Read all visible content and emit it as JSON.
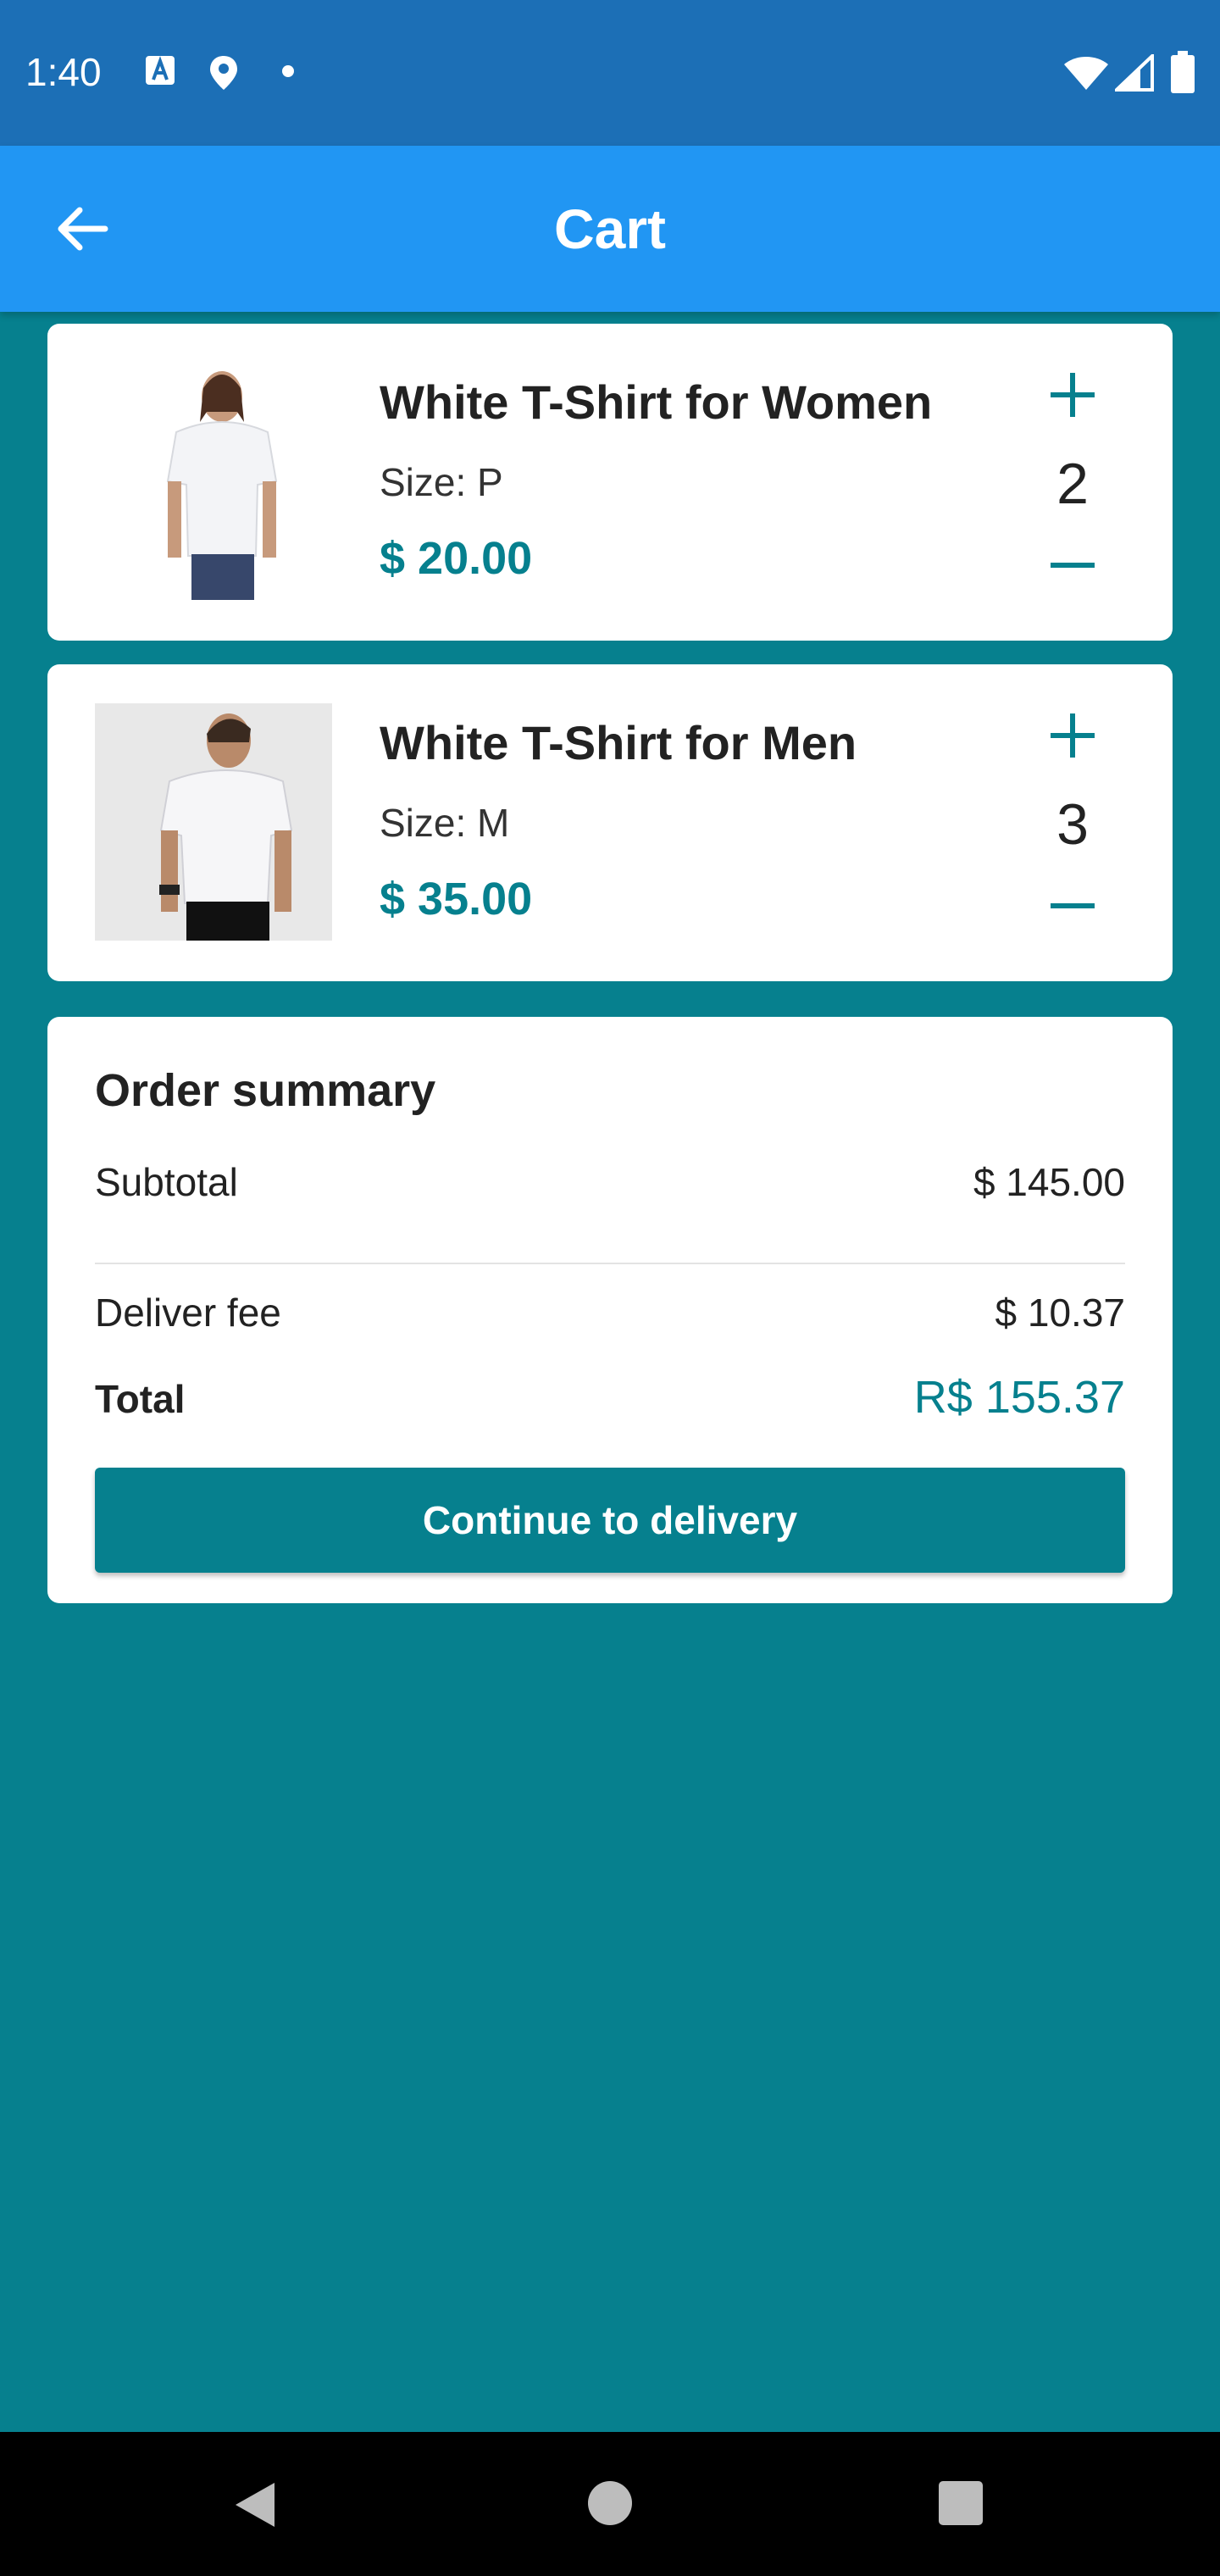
{
  "status_bar": {
    "time": "1:40",
    "icons": [
      "a-notification-icon",
      "location-icon",
      "dot-icon",
      "wifi-icon",
      "signal-icon",
      "battery-icon"
    ]
  },
  "app_bar": {
    "title": "Cart",
    "back_icon": "arrow-back-icon"
  },
  "cart": {
    "items": [
      {
        "name": "White T-Shirt for Women",
        "size": "Size: P",
        "price": "$ 20.00",
        "quantity": "2",
        "image": "woman-white-tshirt"
      },
      {
        "name": "White T-Shirt for Men",
        "size": "Size: M",
        "price": "$ 35.00",
        "quantity": "3",
        "image": "man-white-tshirt"
      }
    ]
  },
  "summary": {
    "title": "Order summary",
    "subtotal_label": "Subtotal",
    "subtotal_value": "$ 145.00",
    "fee_label": "Deliver fee",
    "fee_value": "$ 10.37",
    "total_label": "Total",
    "total_value": "R$ 155.37",
    "button_label": "Continue to delivery"
  },
  "colors": {
    "status_bar": "#1c6fb6",
    "app_bar": "#2196f3",
    "background": "#06808e",
    "accent": "#06808e"
  }
}
